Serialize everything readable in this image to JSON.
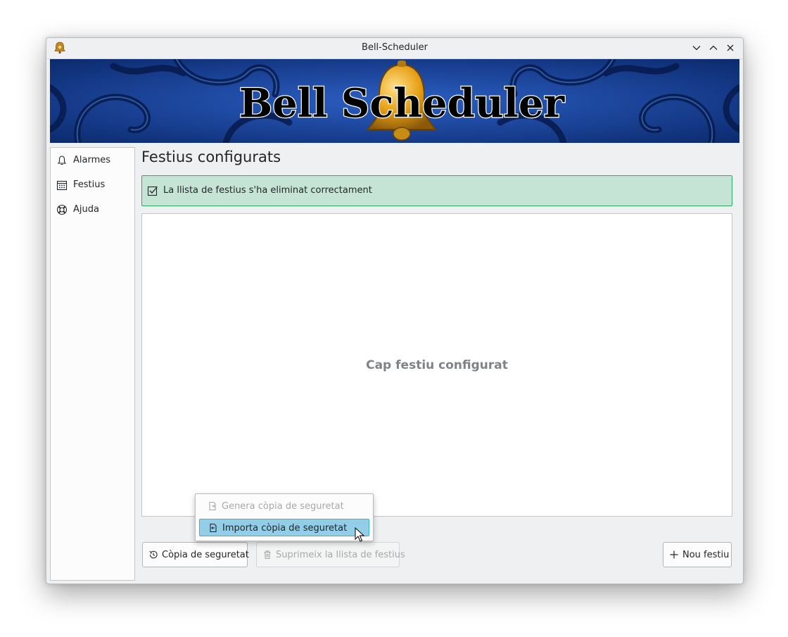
{
  "window": {
    "title": "Bell-Scheduler"
  },
  "banner": {
    "text": "Bell Scheduler"
  },
  "sidebar": {
    "items": [
      {
        "label": "Alarmes",
        "icon": "bell-icon"
      },
      {
        "label": "Festius",
        "icon": "calendar-icon"
      },
      {
        "label": "Ajuda",
        "icon": "lifebuoy-icon"
      }
    ]
  },
  "main": {
    "title": "Festius configurats",
    "notice": "La llista de festius s'ha eliminat correctament",
    "empty_message": "Cap festiu configurat"
  },
  "toolbar": {
    "backup_label": "Còpia de seguretat",
    "delete_label": "Suprimeix la llista de festius",
    "new_label": "Nou festiu"
  },
  "backup_menu": {
    "items": [
      {
        "label": "Genera còpia de seguretat",
        "enabled": false
      },
      {
        "label": "Importa còpia de seguretat",
        "enabled": true,
        "highlighted": true
      }
    ]
  },
  "colors": {
    "accent": "#3daee9",
    "notice_bg": "#c6e4d5",
    "notice_border": "#27ae60",
    "banner_bg": "#1a3f8e",
    "bell": "#e8a319"
  }
}
